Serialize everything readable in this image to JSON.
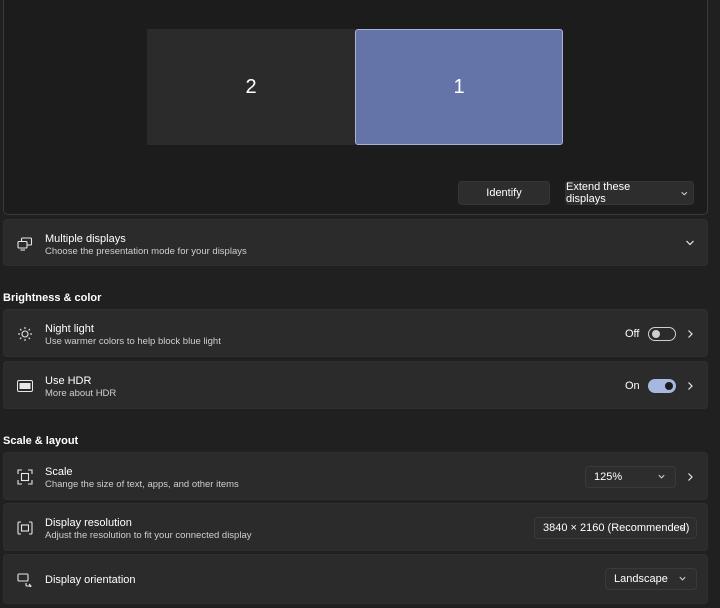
{
  "arrangement": {
    "monitors": [
      {
        "label": "2",
        "selected": false
      },
      {
        "label": "1",
        "selected": true
      }
    ],
    "identify_label": "Identify",
    "extend_label": "Extend these displays"
  },
  "multiple_displays": {
    "title": "Multiple displays",
    "subtitle": "Choose the presentation mode for your displays"
  },
  "brightness_section": {
    "heading": "Brightness & color",
    "night_light": {
      "title": "Night light",
      "subtitle": "Use warmer colors to help block blue light",
      "state_label": "Off",
      "state": false
    },
    "hdr": {
      "title": "Use HDR",
      "subtitle": "More about HDR",
      "state_label": "On",
      "state": true,
      "icon_text": "HDR"
    }
  },
  "scale_section": {
    "heading": "Scale & layout",
    "scale": {
      "title": "Scale",
      "subtitle": "Change the size of text, apps, and other items",
      "value": "125%"
    },
    "resolution": {
      "title": "Display resolution",
      "subtitle": "Adjust the resolution to fit your connected display",
      "value": "3840 × 2160 (Recommended)"
    },
    "orientation": {
      "title": "Display orientation",
      "value": "Landscape"
    }
  },
  "colors": {
    "accent": "#6474a8",
    "toggle_on": "#a7b8e0",
    "card_bg": "#2b2b2b",
    "page_bg": "#202020"
  }
}
